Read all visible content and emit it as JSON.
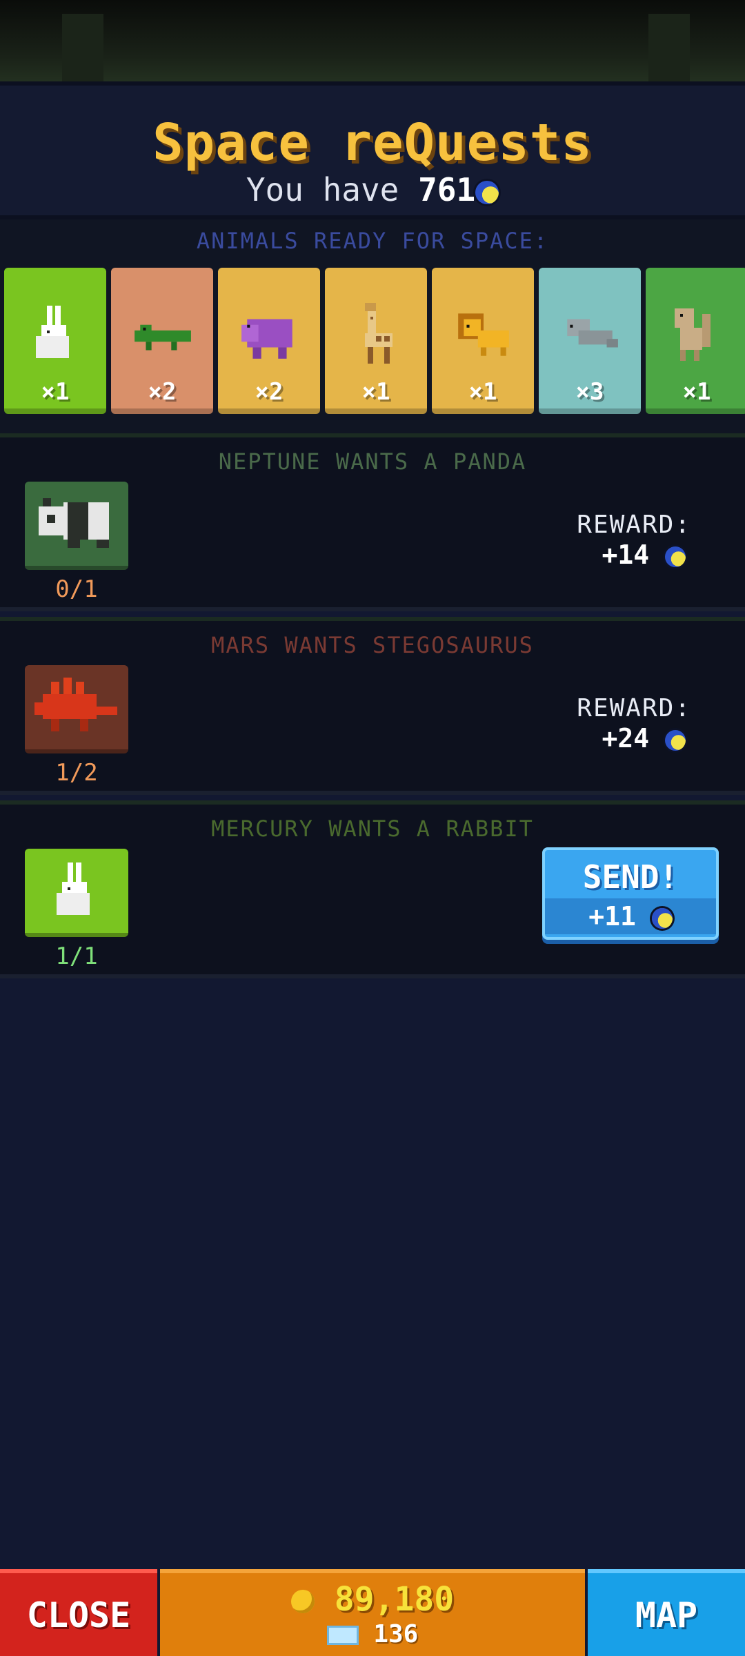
{
  "header": {
    "title": "Space reQuests",
    "balance_prefix": "You have",
    "balance_value": "761"
  },
  "ready": {
    "label": "ANIMALS READY FOR SPACE:",
    "cards": [
      {
        "animal": "rabbit-icon",
        "count": "×1",
        "color": "#7ac520"
      },
      {
        "animal": "crocodile-icon",
        "count": "×2",
        "color": "#d9906a"
      },
      {
        "animal": "hippo-icon",
        "count": "×2",
        "color": "#e5b549"
      },
      {
        "animal": "giraffe-icon",
        "count": "×1",
        "color": "#e5b549"
      },
      {
        "animal": "lion-icon",
        "count": "×1",
        "color": "#e5b549"
      },
      {
        "animal": "seal-icon",
        "count": "×3",
        "color": "#7fc2c0"
      },
      {
        "animal": "monkey-icon",
        "count": "×1",
        "color": "#4ca644"
      }
    ]
  },
  "quests": [
    {
      "title": "NEPTUNE WANTS A PANDA",
      "title_color": "#4a6a4a",
      "icon": "panda-icon",
      "tile_color": "#3a6b3e",
      "progress": "0/1",
      "progress_color": "#f19a5a",
      "reward_label": "REWARD:",
      "reward_value": "+14"
    },
    {
      "title": "MARS WANTS STEGOSAURUS",
      "title_color": "#7a3a33",
      "icon": "stegosaurus-icon",
      "tile_color": "#6a3426",
      "progress": "1/2",
      "progress_color": "#f19a5a",
      "reward_label": "REWARD:",
      "reward_value": "+24"
    },
    {
      "title": "MERCURY WANTS A RABBIT",
      "title_color": "#4a6a2e",
      "icon": "rabbit-icon",
      "tile_color": "#7ac520",
      "progress": "1/1",
      "progress_color": "#7fe07a",
      "send_label": "SEND!",
      "send_value": "+11"
    }
  ],
  "bottom": {
    "close_label": "CLOSE",
    "gold": "89,180",
    "gems": "136",
    "map_label": "MAP"
  }
}
